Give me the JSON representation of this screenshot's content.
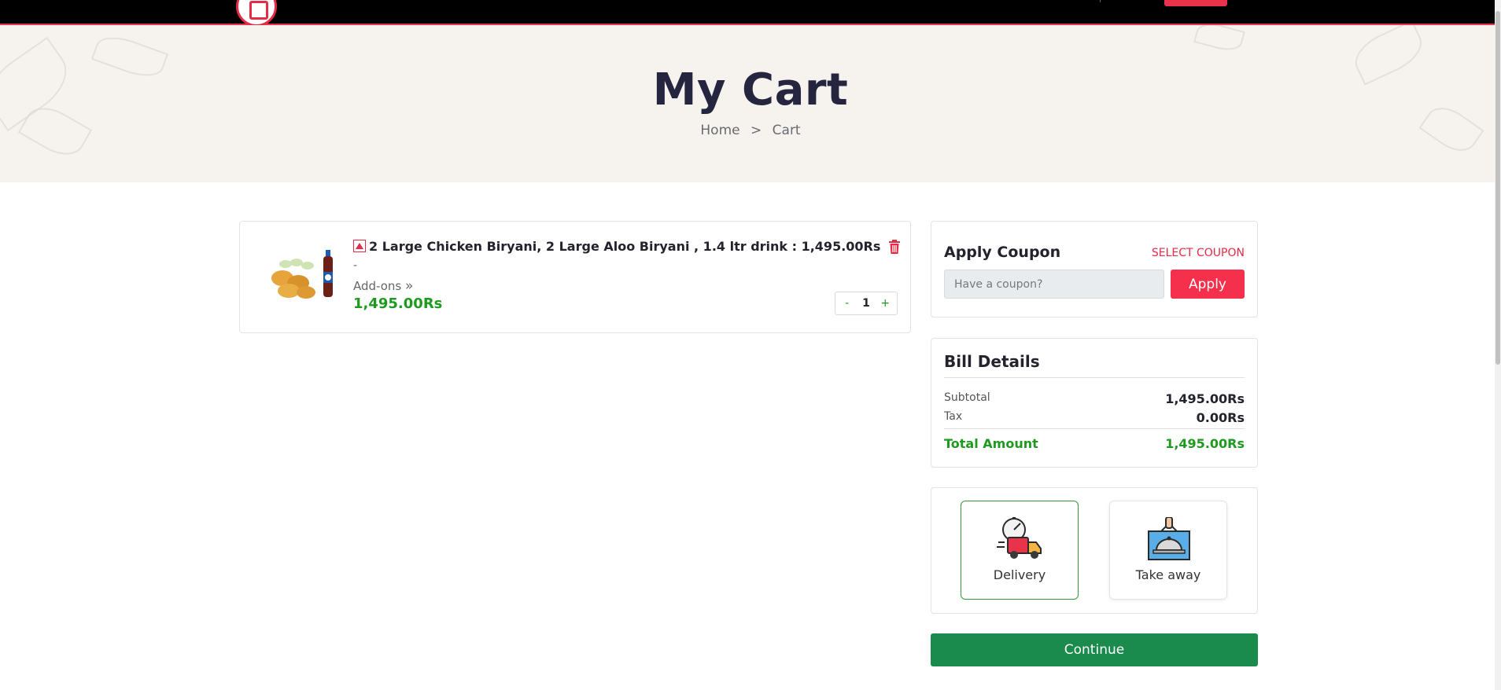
{
  "page": {
    "title": "My Cart"
  },
  "breadcrumb": {
    "home": "Home",
    "separator": ">",
    "current": "Cart"
  },
  "cart": {
    "items": [
      {
        "title": "2 Large Chicken Biryani, 2 Large Aloo Biryani , 1.4 ltr drink : 1,495.00Rs",
        "dash": "-",
        "addons_label": "Add-ons",
        "addons_icon": "»",
        "price": "1,495.00Rs",
        "quantity": "1",
        "qty_minus": "-",
        "qty_plus": "+"
      }
    ]
  },
  "coupon": {
    "title": "Apply Coupon",
    "select_label": "SELECT COUPON",
    "placeholder": "Have a coupon?",
    "apply_label": "Apply"
  },
  "bill": {
    "title": "Bill Details",
    "subtotal_label": "Subtotal",
    "subtotal_value": "1,495.00Rs",
    "tax_label": "Tax",
    "tax_value": "0.00Rs",
    "total_label": "Total Amount",
    "total_value": "1,495.00Rs"
  },
  "order_modes": {
    "delivery_label": "Delivery",
    "takeaway_label": "Take away",
    "selected": "Delivery"
  },
  "continue_label": "Continue",
  "colors": {
    "accent_red": "#f4304c",
    "price_green": "#1e9a1e",
    "continue_green": "#1b8a4d",
    "title_dark": "#252540"
  }
}
